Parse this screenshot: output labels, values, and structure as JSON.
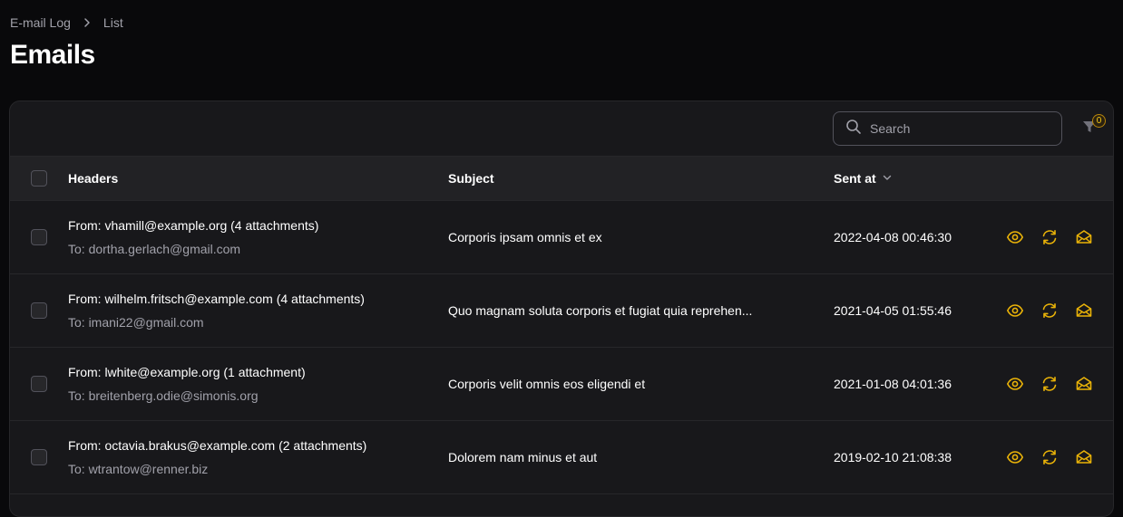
{
  "breadcrumb": {
    "parent": "E-mail Log",
    "current": "List"
  },
  "page": {
    "title": "Emails"
  },
  "toolbar": {
    "search_placeholder": "Search",
    "filter_count": "0"
  },
  "table": {
    "headers": {
      "col1": "Headers",
      "col2": "Subject",
      "col3": "Sent at"
    },
    "rows": [
      {
        "from": "From: vhamill@example.org (4 attachments)",
        "to": "To: dortha.gerlach@gmail.com",
        "subject": "Corporis ipsam omnis et ex",
        "sent_at": "2022-04-08 00:46:30"
      },
      {
        "from": "From: wilhelm.fritsch@example.com (4 attachments)",
        "to": "To: imani22@gmail.com",
        "subject": "Quo magnam soluta corporis et fugiat quia reprehen...",
        "sent_at": "2021-04-05 01:55:46"
      },
      {
        "from": "From: lwhite@example.org (1 attachment)",
        "to": "To: breitenberg.odie@simonis.org",
        "subject": "Corporis velit omnis eos eligendi et",
        "sent_at": "2021-01-08 04:01:36"
      },
      {
        "from": "From: octavia.brakus@example.com (2 attachments)",
        "to": "To: wtrantow@renner.biz",
        "subject": "Dolorem nam minus et aut",
        "sent_at": "2019-02-10 21:08:38"
      }
    ]
  },
  "colors": {
    "accent": "#facc15",
    "background": "#09090b",
    "card": "#18181b"
  },
  "icons": [
    "chevron-right-icon",
    "search-icon",
    "funnel-icon",
    "chevron-down-icon",
    "eye-icon",
    "refresh-icon",
    "envelope-open-icon"
  ]
}
